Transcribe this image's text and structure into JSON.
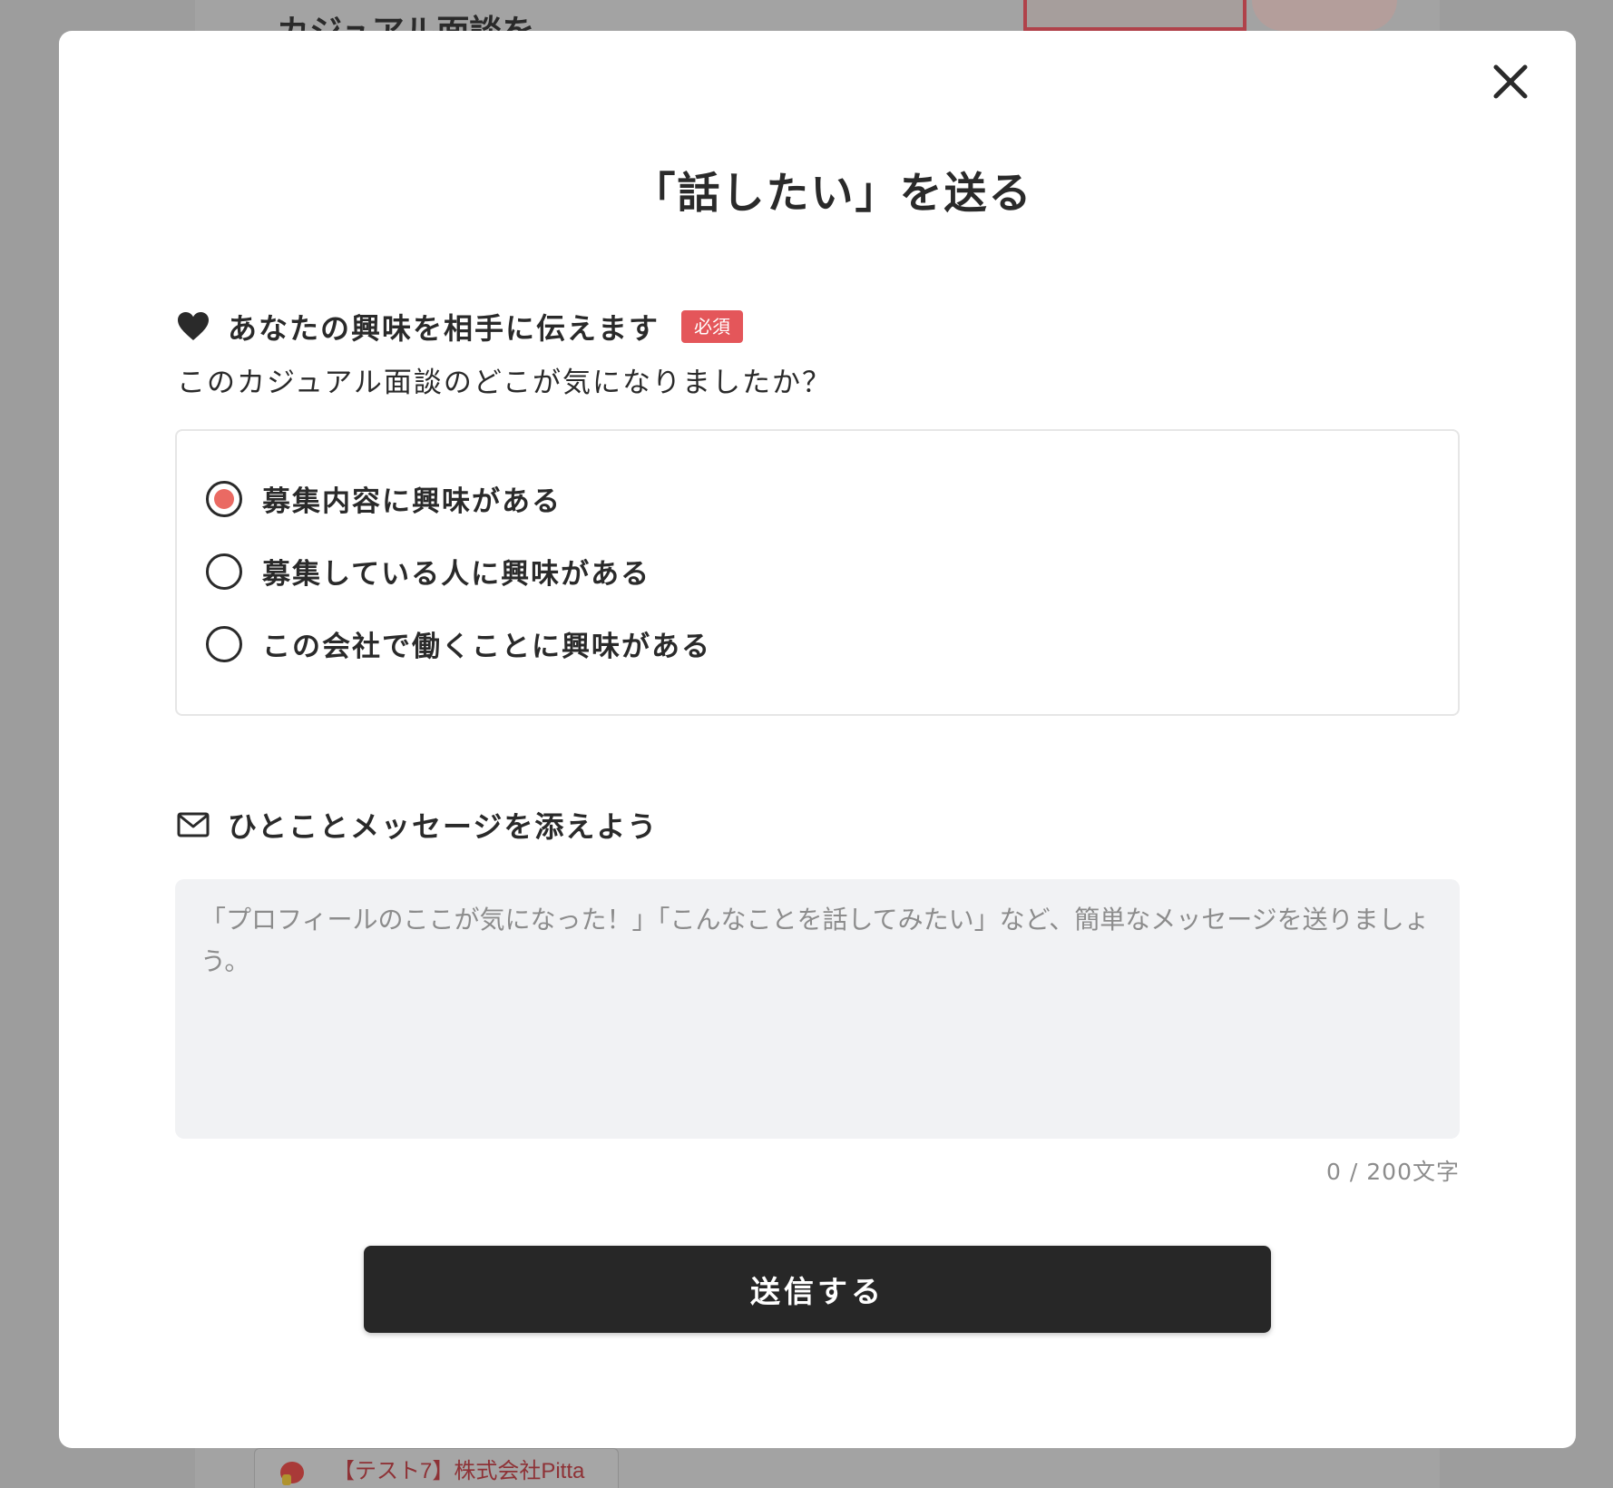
{
  "background": {
    "heading": "カジュアル面談を",
    "company_name": "【テスト7】株式会社Pitta"
  },
  "modal": {
    "title": "「話したい」を送る",
    "close_icon": "close-icon",
    "interest": {
      "icon": "heart-icon",
      "label": "あなたの興味を相手に伝えます",
      "required_badge": "必須",
      "question": "このカジュアル面談のどこが気になりましたか？",
      "options": [
        {
          "label": "募集内容に興味がある",
          "checked": true
        },
        {
          "label": "募集している人に興味がある",
          "checked": false
        },
        {
          "label": "この会社で働くことに興味がある",
          "checked": false
        }
      ]
    },
    "message": {
      "icon": "mail-icon",
      "label": "ひとことメッセージを添えよう",
      "value": "",
      "placeholder": "「プロフィールのここが気になった！」「こんなことを話してみたい」など、簡単なメッセージを送りましょう。",
      "char_count": "0 / 200文字"
    },
    "submit_label": "送信する"
  },
  "colors": {
    "accent": "#ea6a63",
    "badge": "#e4565a",
    "button": "#272727",
    "overlay": "#9d9d9d"
  }
}
